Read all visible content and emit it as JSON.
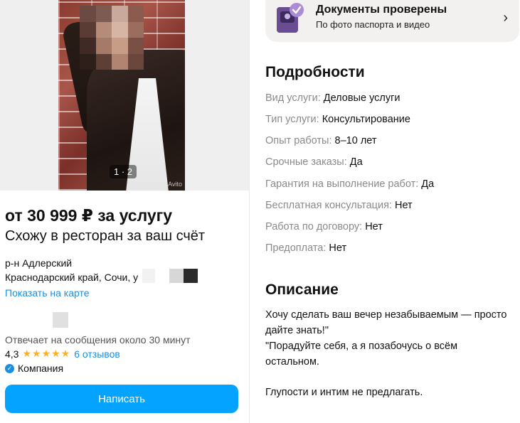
{
  "listing": {
    "photo_counter": "1 · 2",
    "watermark": "Avito",
    "price": "от 30 999 ₽ за услугу",
    "title": "Схожу в ресторан за ваш счёт",
    "district": "р-н Адлерский",
    "address": "Краснодарский край, Сочи, у",
    "map_link": "Показать на карте",
    "response_time": "Отвечает на сообщения около 30 минут",
    "rating": "4,3",
    "stars": "★★★★★",
    "reviews": "6 отзывов",
    "seller_type": "Компания",
    "write_button": "Написать"
  },
  "documents": {
    "title": "Документы проверены",
    "subtitle": "По фото паспорта и видео",
    "chevron": "›"
  },
  "details": {
    "heading": "Подробности",
    "rows": [
      {
        "label": "Вид услуги:",
        "value": "Деловые услуги"
      },
      {
        "label": "Тип услуги:",
        "value": "Консультирование"
      },
      {
        "label": "Опыт работы:",
        "value": "8–10 лет"
      },
      {
        "label": "Срочные заказы:",
        "value": "Да"
      },
      {
        "label": "Гарантия на выполнение работ:",
        "value": "Да"
      },
      {
        "label": "Бесплатная консультация:",
        "value": "Нет"
      },
      {
        "label": "Работа по договору:",
        "value": "Нет"
      },
      {
        "label": "Предоплата:",
        "value": "Нет"
      }
    ]
  },
  "description": {
    "heading": "Описание",
    "lines": [
      "Хочу сделать ваш вечер незабываемым — просто",
      "дайте знать!\"",
      "\"Порадуйте себя, а я позабочусь о всём",
      "остальном.",
      "",
      "Глупости и интим не предлагать."
    ]
  },
  "colors": {
    "accent": "#04a3ff",
    "link": "#1a8ee1",
    "star": "#ffb021",
    "label_grey": "#8a8a8a"
  }
}
